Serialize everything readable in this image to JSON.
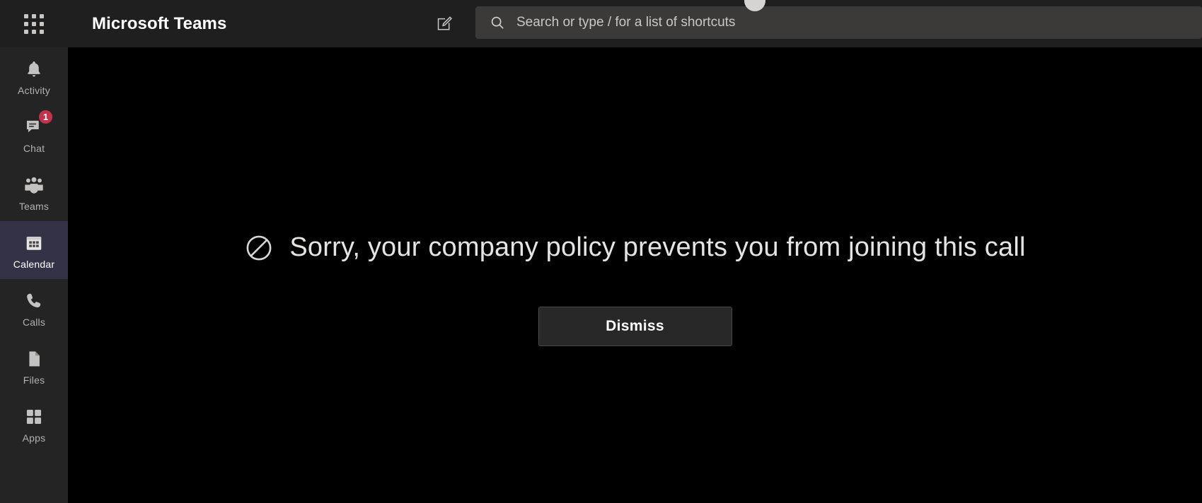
{
  "app": {
    "title": "Microsoft Teams",
    "theme": "dark",
    "accent_color": "#333246",
    "badge_color": "#c4314b",
    "content_background": "#000000",
    "rail_background": "#252424",
    "topbar_background": "#201f1f"
  },
  "topbar": {
    "app_launcher_icon": "grid-apps-icon",
    "title": "Microsoft Teams",
    "compose_icon": "compose-pencil-icon",
    "search": {
      "icon": "search-icon",
      "placeholder": "Search or type / for a list of shortcuts",
      "value": ""
    },
    "avatar_icon": "user-avatar"
  },
  "sidebar": {
    "items": [
      {
        "label": "Activity",
        "icon": "bell-icon",
        "active": false,
        "badge": ""
      },
      {
        "label": "Chat",
        "icon": "chat-icon",
        "active": false,
        "badge": "1"
      },
      {
        "label": "Teams",
        "icon": "people-icon",
        "active": false,
        "badge": ""
      },
      {
        "label": "Calendar",
        "icon": "calendar-icon",
        "active": true,
        "badge": ""
      },
      {
        "label": "Calls",
        "icon": "phone-icon",
        "active": false,
        "badge": ""
      },
      {
        "label": "Files",
        "icon": "file-icon",
        "active": false,
        "badge": ""
      },
      {
        "label": "Apps",
        "icon": "apps-grid-icon",
        "active": false,
        "badge": ""
      }
    ]
  },
  "main": {
    "status_icon": "blocked-circle-slash-icon",
    "message": "Sorry, your company policy prevents you from joining this call",
    "dismiss_label": "Dismiss"
  }
}
